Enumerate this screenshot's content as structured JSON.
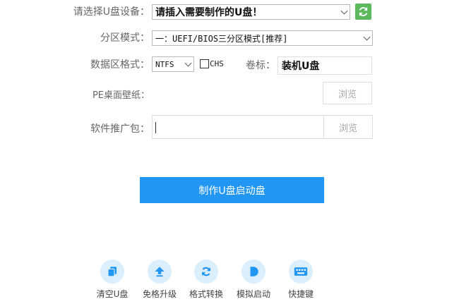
{
  "device": {
    "label": "请选择U盘设备：",
    "value": "请插入需要制作的U盘！"
  },
  "partition": {
    "label": "分区模式：",
    "value": "一：UEFI/BIOS三分区模式[推荐]"
  },
  "format": {
    "label": "数据区格式：",
    "value": "NTFS",
    "chs_label": "CHS",
    "volume_label": "卷标：",
    "volume_value": "装机U盘"
  },
  "wallpaper": {
    "label": "PE桌面壁纸：",
    "value": "",
    "browse": "浏览"
  },
  "software": {
    "label": "软件推广包：",
    "value": "",
    "browse": "浏览"
  },
  "primary_button": "制作U盘启动盘",
  "tools": [
    {
      "label": "清空U盘",
      "icon": "copy-icon"
    },
    {
      "label": "免格升级",
      "icon": "upload-icon"
    },
    {
      "label": "格式转换",
      "icon": "convert-icon"
    },
    {
      "label": "模拟启动",
      "icon": "play-icon"
    },
    {
      "label": "快捷键",
      "icon": "keyboard-icon"
    }
  ],
  "colors": {
    "accent": "#2196f3",
    "refresh": "#5cb85c",
    "icon_bg": "#dbeefc"
  }
}
